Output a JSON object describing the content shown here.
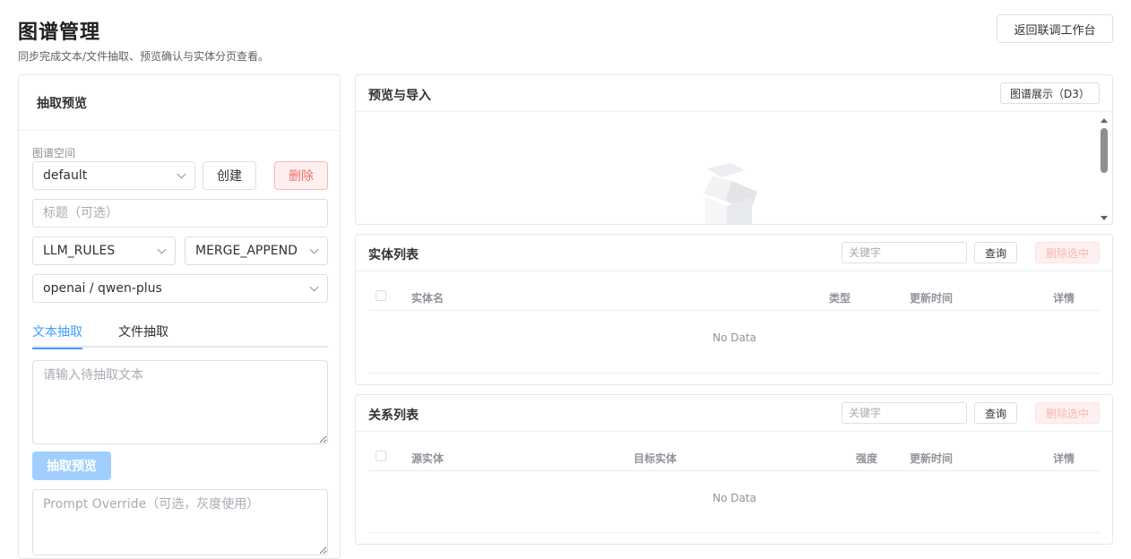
{
  "header": {
    "title": "图谱管理",
    "subtitle": "同步完成文本/文件抽取、预览确认与实体分页查看。",
    "back_button": "返回联调工作台"
  },
  "extract_panel": {
    "title": "抽取预览",
    "space_label": "图谱空间",
    "space_value": "default",
    "create_button": "创建",
    "delete_button": "删除",
    "title_placeholder": "标题（可选）",
    "mode_value": "LLM_RULES",
    "merge_value": "MERGE_APPEND",
    "model_value": "openai / qwen-plus",
    "tabs": [
      {
        "label": "文本抽取",
        "active": true
      },
      {
        "label": "文件抽取",
        "active": false
      }
    ],
    "text_placeholder": "请输入待抽取文本",
    "preview_button": "抽取预览",
    "prompt_placeholder": "Prompt Override（可选，灰度使用）"
  },
  "preview_card": {
    "title": "预览与导入",
    "graph_button": "图谱展示（D3）"
  },
  "entity_card": {
    "title": "实体列表",
    "keyword_placeholder": "关键字",
    "query_button": "查询",
    "delete_selected_button": "删除选中",
    "columns": [
      "实体名",
      "类型",
      "更新时间",
      "详情"
    ],
    "empty_text": "No Data"
  },
  "relation_card": {
    "title": "关系列表",
    "keyword_placeholder": "关键字",
    "query_button": "查询",
    "delete_selected_button": "删除选中",
    "columns": [
      "源实体",
      "目标实体",
      "强度",
      "更新时间",
      "详情"
    ],
    "empty_text": "No Data"
  },
  "colors": {
    "primary": "#409eff",
    "danger": "#f56c6c",
    "border": "#dcdfe6"
  }
}
